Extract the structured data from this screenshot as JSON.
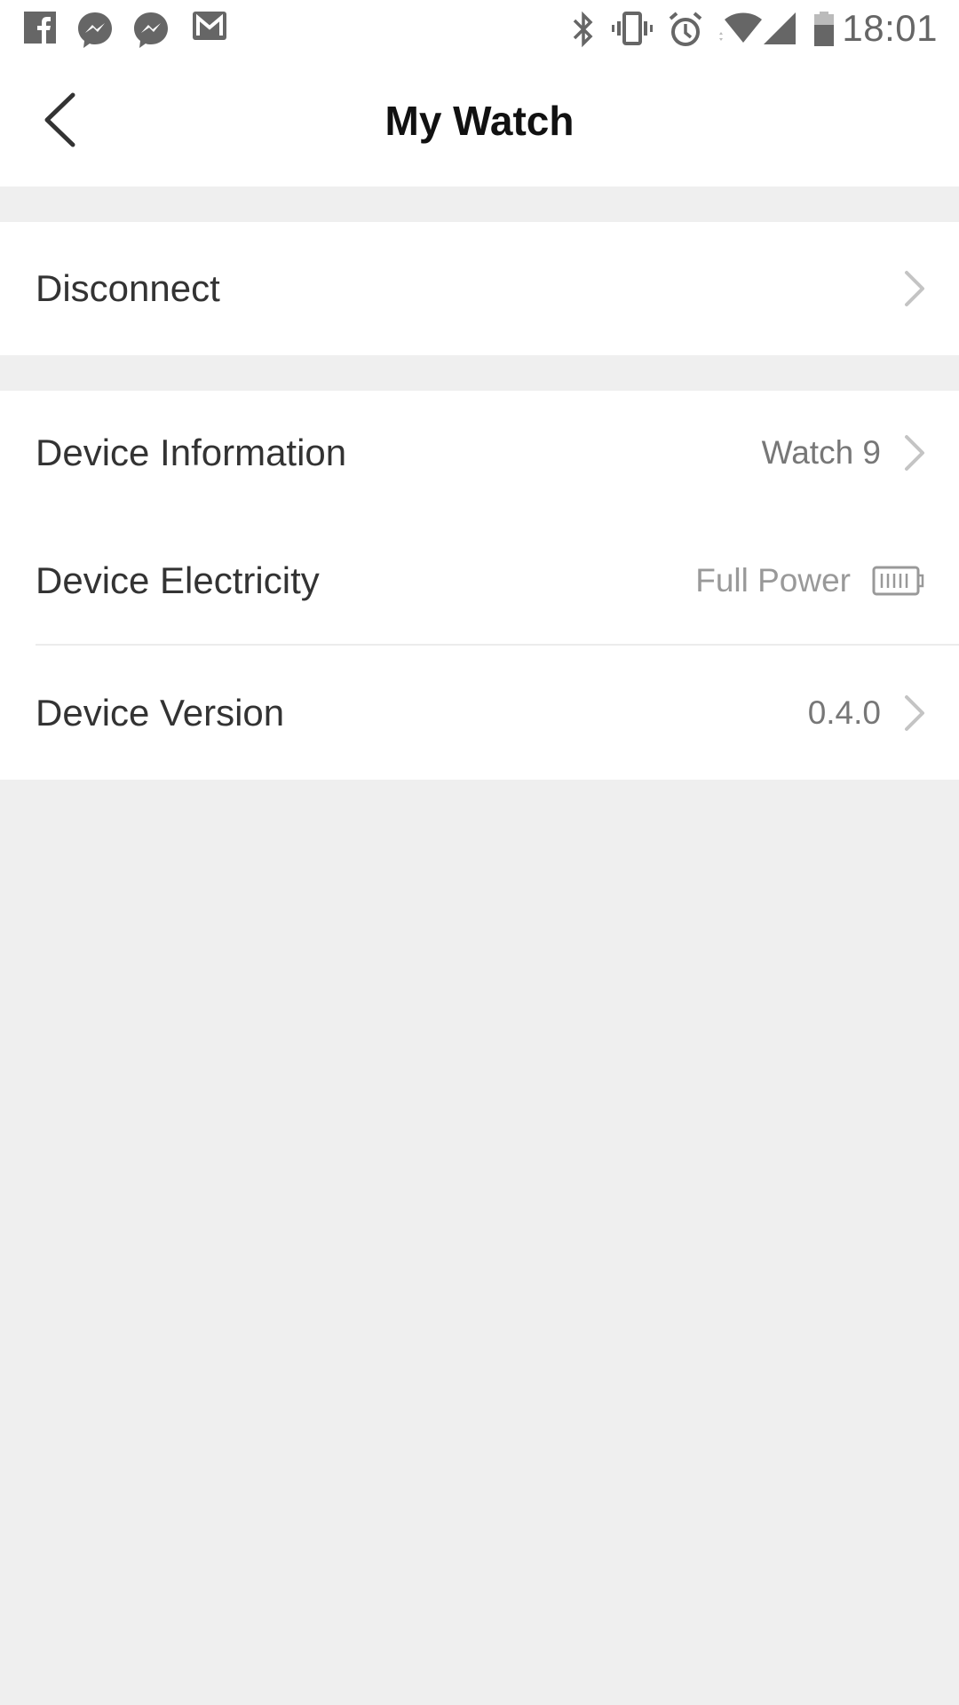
{
  "status_bar": {
    "notifications": [
      "facebook-icon",
      "messenger-icon",
      "messenger-icon",
      "gmail-icon"
    ],
    "system_icons": [
      "bluetooth-icon",
      "vibrate-icon",
      "alarm-icon",
      "wifi-icon",
      "cell-signal-icon",
      "battery-icon"
    ],
    "time": "18:01"
  },
  "header": {
    "back_icon": "chevron-left-icon",
    "title": "My Watch"
  },
  "groups": [
    {
      "items": [
        {
          "label": "Disconnect",
          "value": "",
          "trailing": "chevron-right-icon"
        }
      ]
    },
    {
      "items": [
        {
          "label": "Device Information",
          "value": "Watch 9",
          "trailing": "chevron-right-icon"
        },
        {
          "label": "Device Electricity",
          "value": "Full Power",
          "trailing": "battery-full-icon",
          "battery_level": 1.0
        },
        {
          "label": "Device Version",
          "value": "0.4.0",
          "trailing": "chevron-right-icon"
        }
      ]
    }
  ],
  "colors": {
    "background": "#efefef",
    "surface": "#ffffff",
    "text_primary": "#333333",
    "text_secondary": "#777777",
    "icon_muted": "#c4c4c4"
  }
}
